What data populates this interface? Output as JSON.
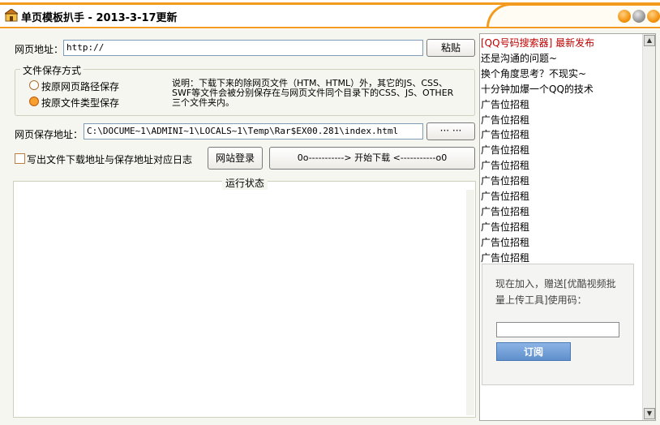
{
  "window": {
    "title": "单页模板扒手 - 2013-3-17更新"
  },
  "url": {
    "label": "网页地址：",
    "value": "http://",
    "paste_label": "粘贴"
  },
  "save_mode": {
    "group_title": "文件保存方式",
    "options": [
      {
        "label": "按原网页路径保存",
        "checked": false
      },
      {
        "label": "按原文件类型保存",
        "checked": true
      }
    ],
    "note": "说明：下载下来的除网页文件（HTM、HTML）外，其它的JS、CSS、SWF等文件会被分别保存在与网页文件同个目录下的CSS、JS、OTHER 三个文件夹内。"
  },
  "save_path": {
    "label": "网页保存地址：",
    "value": "C:\\DOCUME~1\\ADMINI~1\\LOCALS~1\\Temp\\Rar$EX00.281\\index.html",
    "browse_label": "··· ···"
  },
  "log_checkbox": {
    "label": "写出文件下载地址与保存地址对应日志",
    "checked": false
  },
  "login_button": "网站登录",
  "download_button": "0o-----------> 开始下载 <-----------o0",
  "status": {
    "title": "运行状态"
  },
  "ads": {
    "lines": [
      {
        "text": "[QQ号码搜索器] 最新发布",
        "color": "#c00000"
      },
      {
        "text": "还是沟通的问题~",
        "color": "#000000"
      },
      {
        "text": "换个角度思考？不现实~",
        "color": "#000000"
      },
      {
        "text": "十分钟加爆一个QQ的技术",
        "color": "#000000"
      },
      {
        "text": "广告位招租",
        "color": "#000000"
      },
      {
        "text": "广告位招租",
        "color": "#000000"
      },
      {
        "text": "广告位招租",
        "color": "#000000"
      },
      {
        "text": "广告位招租",
        "color": "#000000"
      },
      {
        "text": "广告位招租",
        "color": "#000000"
      },
      {
        "text": "广告位招租",
        "color": "#000000"
      },
      {
        "text": "广告位招租",
        "color": "#000000"
      },
      {
        "text": "广告位招租",
        "color": "#000000"
      },
      {
        "text": "广告位招租",
        "color": "#000000"
      },
      {
        "text": "广告位招租",
        "color": "#000000"
      },
      {
        "text": "广告位招租",
        "color": "#000000"
      }
    ],
    "subscribe": {
      "text": "现在加入，赠送[优酷视频批量上传工具]使用码：",
      "email_value": "",
      "button_label": "订阅"
    }
  },
  "colors": {
    "accent": "#f29b1e",
    "radio_checked": "#f7a030",
    "subscribe_button": "#6f9bd5"
  }
}
